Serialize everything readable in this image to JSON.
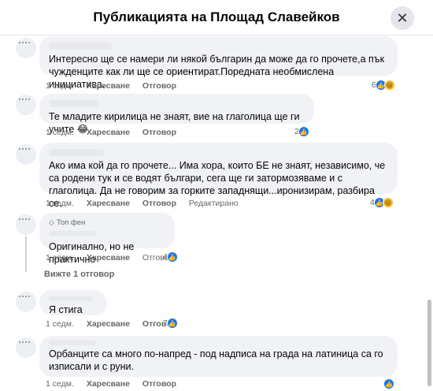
{
  "header": {
    "title": "Публикацията на Площад Славейков",
    "close_icon": "✕"
  },
  "comments": [
    {
      "text": "Интересно ще се намери ли някой българин да може да го прочете,а пък чужденците как ли ще се ориентират.Поредната необмислена инициатива.",
      "time": "1 седм.",
      "like": "Харесване",
      "reply": "Отговор",
      "count": "6",
      "reactions": [
        "like",
        "haha"
      ]
    },
    {
      "text": "Те младите кирилица не знаят, вие на глаголица ще ги учите 😂",
      "time": "1 седм.",
      "like": "Харесване",
      "reply": "Отговор",
      "count": "2",
      "reactions": [
        "like"
      ]
    },
    {
      "text": "Ако има кой да го прочете... Има хора, които БЕ не знаят, независимо, че са родени тук и се водят българи, сега ще ги затормозяваме и с глаголица. Да не говорим за горките западнящи...иронизирам, разбира се.",
      "time": "1 седм.",
      "like": "Харесване",
      "reply": "Отговор",
      "edited": "Редактирано",
      "count": "4",
      "reactions": [
        "like",
        "haha"
      ]
    },
    {
      "badge": "Топ фен",
      "text": "Оригинално, но не практично",
      "time": "1 седм.",
      "like": "Харесване",
      "reply": "Отговс",
      "count": "4",
      "reactions": [
        "like"
      ]
    },
    {
      "text": "Я стига",
      "time": "1 седм.",
      "like": "Харесване",
      "reply": "Отговор",
      "count": "7",
      "reactions": [
        "like"
      ]
    },
    {
      "text": "Орбанците са много по-напред - под надписа на града на латиница са го изписали и с руни.",
      "time": "1 седм.",
      "like": "Харесване",
      "reply": "Отговор",
      "count": "",
      "reactions": [
        "like"
      ]
    }
  ],
  "view_replies": "Вижте 1 отговор",
  "colors": {
    "accent": "#1877f2",
    "bubble": "#f0f2f5",
    "muted": "#65676b"
  }
}
